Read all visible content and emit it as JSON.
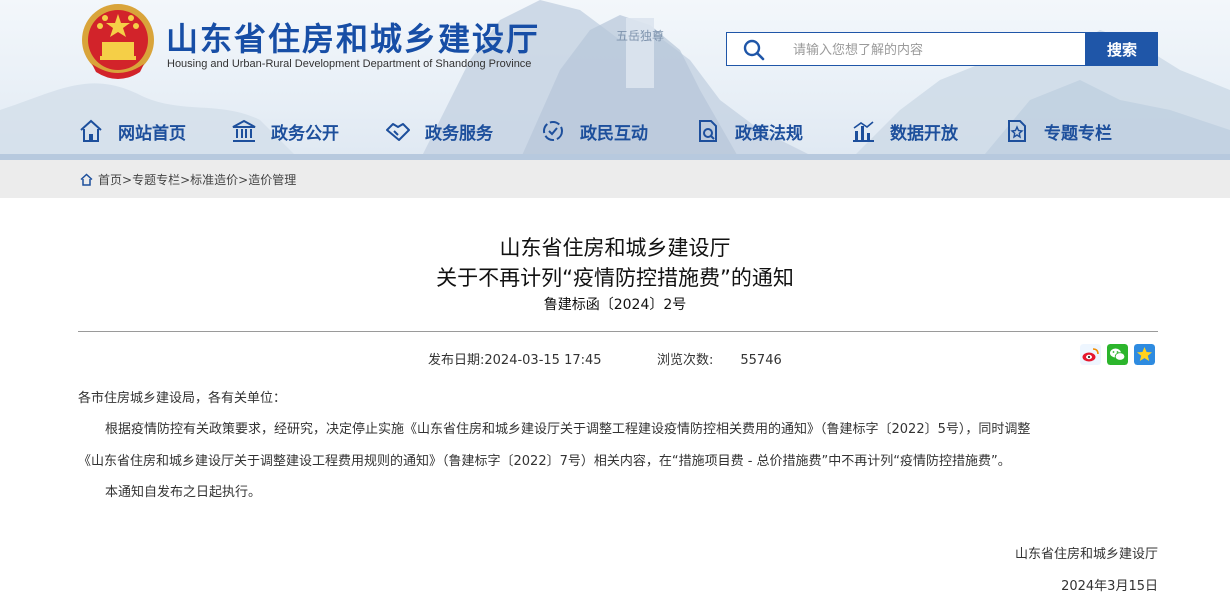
{
  "header": {
    "title": "山东省住房和城乡建设厅",
    "subtitle": "Housing and Urban-Rural Development Department of Shandong Province",
    "watermark": "五岳独尊"
  },
  "search": {
    "placeholder": "请输入您想了解的内容",
    "button_label": "搜索"
  },
  "nav": {
    "items": [
      {
        "label": "网站首页",
        "icon": "home-icon"
      },
      {
        "label": "政务公开",
        "icon": "government-building-icon"
      },
      {
        "label": "政务服务",
        "icon": "handshake-icon"
      },
      {
        "label": "政民互动",
        "icon": "interaction-icon"
      },
      {
        "label": "政策法规",
        "icon": "policy-document-icon"
      },
      {
        "label": "数据开放",
        "icon": "bar-chart-icon"
      },
      {
        "label": "专题专栏",
        "icon": "star-document-icon"
      }
    ]
  },
  "breadcrumb": {
    "items": [
      "首页",
      "专题专栏",
      "标准造价",
      "造价管理"
    ],
    "separator": ">"
  },
  "article": {
    "title_line1": "山东省住房和城乡建设厅",
    "title_line2": "关于不再计列“疫情防控措施费”的通知",
    "doc_number": "鲁建标函〔2024〕2号",
    "publish_label": "发布日期:",
    "publish_date": "2024-03-15 17:45",
    "views_label": "浏览次数:",
    "views_count": "55746",
    "salutation": "各市住房城乡建设局，各有关单位：",
    "para1_line1": "根据疫情防控有关政策要求，经研究，决定停止实施《山东省住房和城乡建设厅关于调整工程建设疫情防控相关费用的通知》（鲁建标字〔2022〕5号），同时调整",
    "para1_line2": "《山东省住房和城乡建设厅关于调整建设工程费用规则的通知》（鲁建标字〔2022〕7号）相关内容，在“措施项目费 - 总价措施费”中不再计列“疫情防控措施费”。",
    "para2": "本通知自发布之日起执行。",
    "signature": "山东省住房和城乡建设厅",
    "signature_date": "2024年3月15日"
  },
  "share": {
    "icons": [
      "weibo-icon",
      "wechat-icon",
      "favorite-star-icon"
    ]
  },
  "colors": {
    "brand_blue": "#1f56a8",
    "nav_text": "#1d4f9c",
    "breadcrumb_bg": "#ececec"
  }
}
